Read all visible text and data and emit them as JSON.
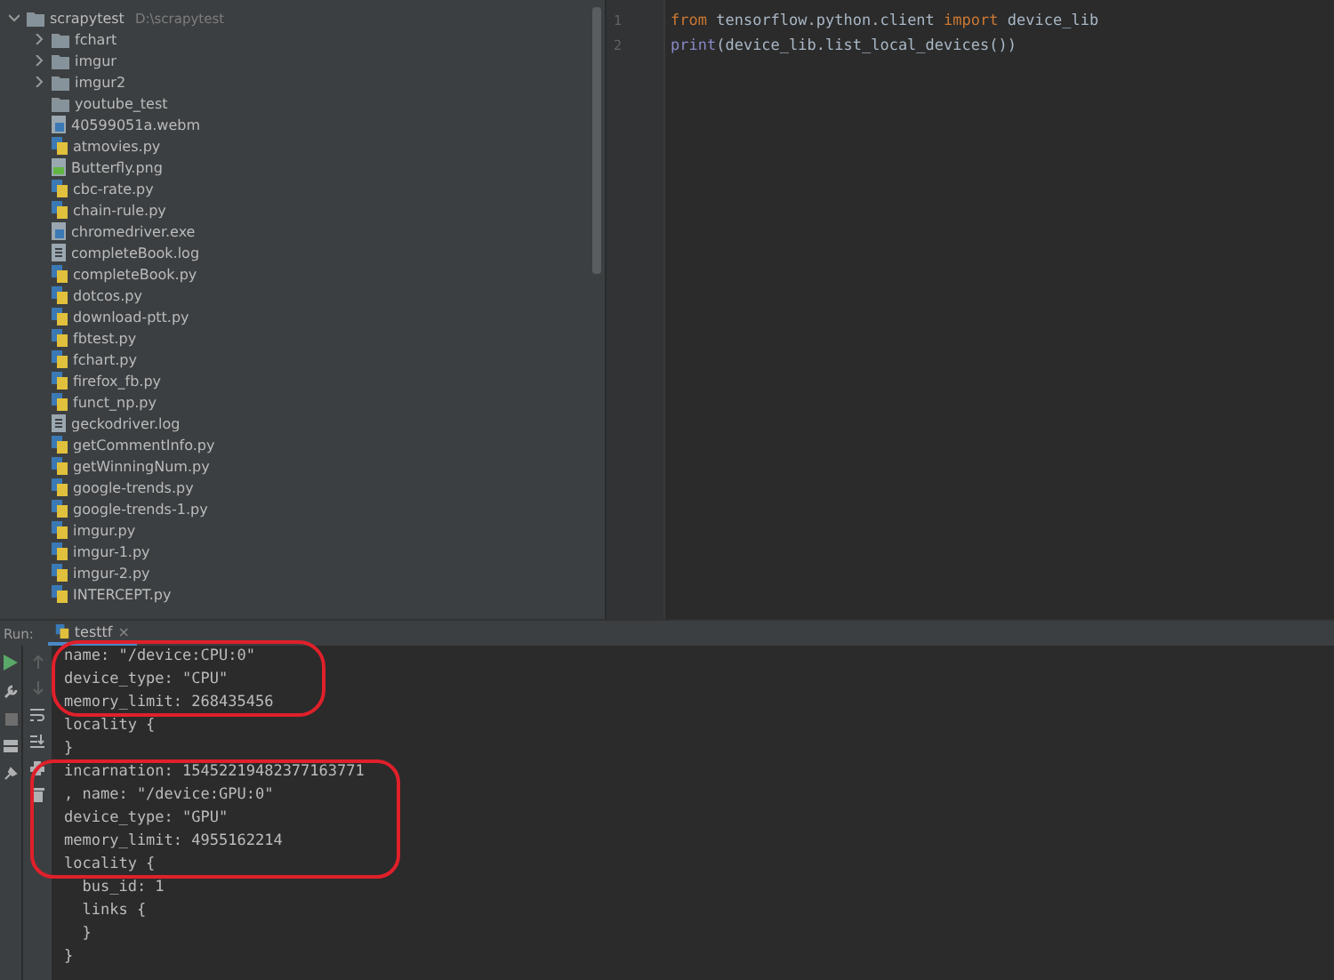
{
  "project_tree": {
    "name": "scrapytest",
    "path": "D:\\scrapytest",
    "kind": "folder",
    "expanded": true,
    "children": [
      {
        "name": "fchart",
        "kind": "folder",
        "expanded": false
      },
      {
        "name": "imgur",
        "kind": "folder",
        "expanded": false
      },
      {
        "name": "imgur2",
        "kind": "folder",
        "expanded": false
      },
      {
        "name": "youtube_test",
        "kind": "folder"
      },
      {
        "name": "40599051a.webm",
        "kind": "file"
      },
      {
        "name": "atmovies.py",
        "kind": "python"
      },
      {
        "name": "Butterfly.png",
        "kind": "image"
      },
      {
        "name": "cbc-rate.py",
        "kind": "python"
      },
      {
        "name": "chain-rule.py",
        "kind": "python"
      },
      {
        "name": "chromedriver.exe",
        "kind": "file"
      },
      {
        "name": "completeBook.log",
        "kind": "text"
      },
      {
        "name": "completeBook.py",
        "kind": "python"
      },
      {
        "name": "dotcos.py",
        "kind": "python"
      },
      {
        "name": "download-ptt.py",
        "kind": "python"
      },
      {
        "name": "fbtest.py",
        "kind": "python"
      },
      {
        "name": "fchart.py",
        "kind": "python"
      },
      {
        "name": "firefox_fb.py",
        "kind": "python"
      },
      {
        "name": "funct_np.py",
        "kind": "python"
      },
      {
        "name": "geckodriver.log",
        "kind": "text"
      },
      {
        "name": "getCommentInfo.py",
        "kind": "python"
      },
      {
        "name": "getWinningNum.py",
        "kind": "python"
      },
      {
        "name": "google-trends.py",
        "kind": "python"
      },
      {
        "name": "google-trends-1.py",
        "kind": "python"
      },
      {
        "name": "imgur.py",
        "kind": "python"
      },
      {
        "name": "imgur-1.py",
        "kind": "python"
      },
      {
        "name": "imgur-2.py",
        "kind": "python"
      },
      {
        "name": "INTERCEPT.py",
        "kind": "python"
      }
    ]
  },
  "editor": {
    "lines": [
      {
        "number": "1",
        "tokens": [
          {
            "kind": "keyword",
            "text": "from"
          },
          {
            "kind": "plain",
            "text": " tensorflow.python.client "
          },
          {
            "kind": "keyword",
            "text": "import"
          },
          {
            "kind": "plain",
            "text": " device_lib"
          }
        ]
      },
      {
        "number": "2",
        "tokens": [
          {
            "kind": "builtin",
            "text": "print"
          },
          {
            "kind": "plain",
            "text": "(device_lib.list_local_devices())"
          }
        ]
      }
    ]
  },
  "run_panel": {
    "label": "Run:",
    "tabs": [
      {
        "label": "testtf",
        "selected": true,
        "close": "×"
      }
    ],
    "console_lines": [
      "name: \"/device:CPU:0\"",
      "device_type: \"CPU\"",
      "memory_limit: 268435456",
      "locality {",
      "}",
      "incarnation: 15452219482377163771",
      ", name: \"/device:GPU:0\"",
      "device_type: \"GPU\"",
      "memory_limit: 4955162214",
      "locality {",
      "  bus_id: 1",
      "  links {",
      "  }",
      "}"
    ]
  }
}
